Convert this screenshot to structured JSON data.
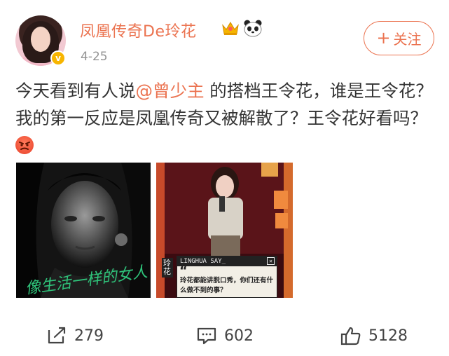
{
  "user": {
    "name": "凤凰传奇De玲花",
    "time": "4-25",
    "verified_icon": "v-badge-icon"
  },
  "follow_button": {
    "plus": "+",
    "label": "关注"
  },
  "post": {
    "text_before": "今天看到有人说",
    "mention": "@曾少主",
    "text_after": " 的搭档王令花，谁是王令花？我的第一反应是凤凰传奇又被解散了？王令花好看吗？"
  },
  "images": {
    "first_caption": "像生活一样的女人",
    "second": {
      "side_label": "玲花",
      "dialog_title": "LINGHUA SAY_",
      "dialog_quote": "“",
      "dialog_text": "玲花都能讲脱口秀，你们还有什么做不到的事？"
    }
  },
  "actions": {
    "repost": "279",
    "comment": "602",
    "like": "5128"
  },
  "colors": {
    "brand": "#eb7350",
    "text": "#333333",
    "muted": "#939393"
  }
}
